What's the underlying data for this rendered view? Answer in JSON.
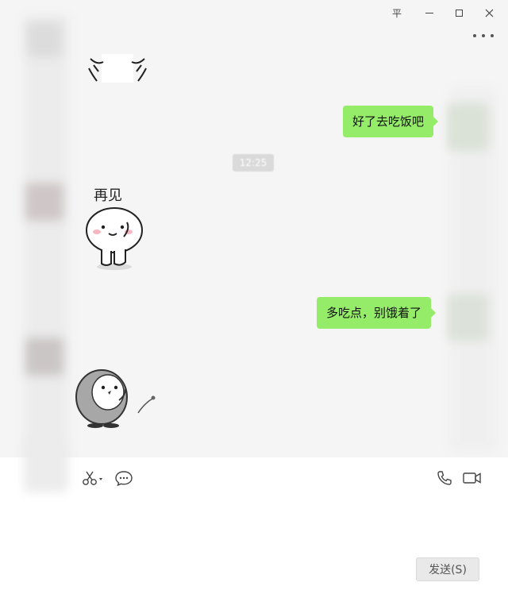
{
  "window": {
    "pin_label": "平"
  },
  "messages": [
    {
      "side": "right",
      "text": "好了去吃饭吧"
    },
    {
      "side": "center",
      "text": "12:25"
    },
    {
      "side": "left",
      "sticker": "再见"
    },
    {
      "side": "right",
      "text": "多吃点，别饿着了"
    },
    {
      "side": "left",
      "sticker": "penguin"
    }
  ],
  "sticker": {
    "caption": "再见"
  },
  "timestamp": "12:25",
  "toolbar": {
    "left_icons": [
      "scissors-icon",
      "chat-history-icon"
    ],
    "right_icons": [
      "phone-icon",
      "video-call-icon"
    ]
  },
  "send_button_label": "发送(S)",
  "colors": {
    "bubble_green": "#95ec69",
    "chat_bg": "#f5f5f5",
    "input_bg": "#ffffff"
  }
}
